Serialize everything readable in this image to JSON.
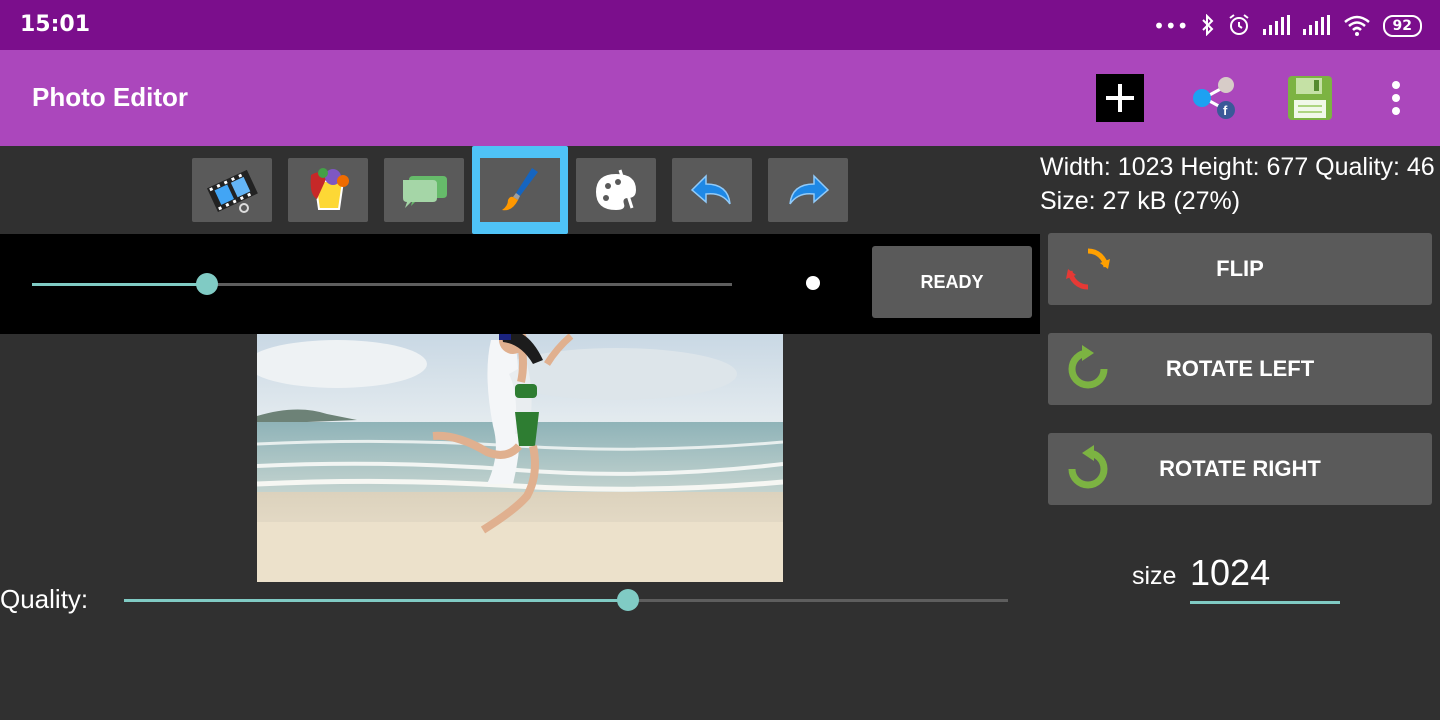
{
  "status_bar": {
    "time": "15:01",
    "icons": [
      "more-icon",
      "bluetooth-icon",
      "alarm-icon",
      "signal-icon",
      "signal-icon",
      "wifi-icon"
    ],
    "battery": "92"
  },
  "app_bar": {
    "title": "Photo Editor",
    "background": "#ab47bc",
    "actions": [
      "add-icon",
      "share-icon",
      "save-icon",
      "more-vert-icon"
    ]
  },
  "toolbar": {
    "tools": [
      {
        "icon": "filmstrip-icon"
      },
      {
        "icon": "paint-bucket-icon"
      },
      {
        "icon": "speech-bubble-icon"
      },
      {
        "icon": "brush-icon",
        "active": true
      },
      {
        "icon": "palette-icon"
      },
      {
        "icon": "undo-icon"
      },
      {
        "icon": "redo-icon"
      }
    ],
    "active_color": "#4fc3f7"
  },
  "image_info": {
    "text": "Width: 1023 Height: 677 Quality: 46 Size: 27 kB (27%)"
  },
  "brush_panel": {
    "brush_size_fraction": 0.25,
    "ready_label": "READY"
  },
  "actions": {
    "flip_label": "FLIP",
    "rotate_left_label": "ROTATE LEFT",
    "rotate_right_label": "ROTATE RIGHT"
  },
  "quality": {
    "label": "Quality:",
    "value_fraction": 0.57
  },
  "size": {
    "label": "size",
    "value": "1024"
  },
  "accent_color": "#80cbc4"
}
